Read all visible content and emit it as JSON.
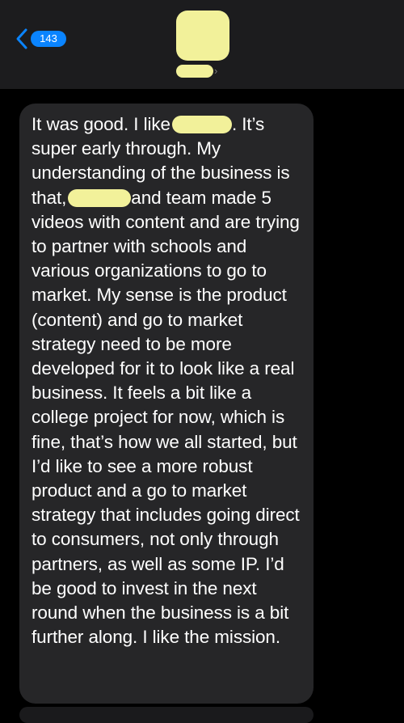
{
  "header": {
    "back_badge": "143",
    "contact_name": ""
  },
  "colors": {
    "background": "#000000",
    "header_background": "#1c1c1e",
    "accent": "#0a84ff",
    "bubble_background": "#262628",
    "redaction": "#f2f19a",
    "text": "#ffffff"
  },
  "icons": {
    "back": "chevron-left-icon",
    "contact": "chevron-right-icon"
  },
  "message": {
    "part1": "It was good. I like",
    "part2": ". It’s super early through. My understanding of the business is that,",
    "part3": "and team made 5 videos with content and are trying to partner with schools and various organizations to go to market. My sense is the product (content) and go to market strategy need to be more developed for it to look like a real business. It feels a bit like a college project for now, which is fine, that’s how we all started, but I’d like to see a more robust product and a go to market strategy that includes going direct to consumers, not only through partners, as well as some IP. I’d be good to invest in the next round when the business is a bit further along. I like the mission."
  }
}
